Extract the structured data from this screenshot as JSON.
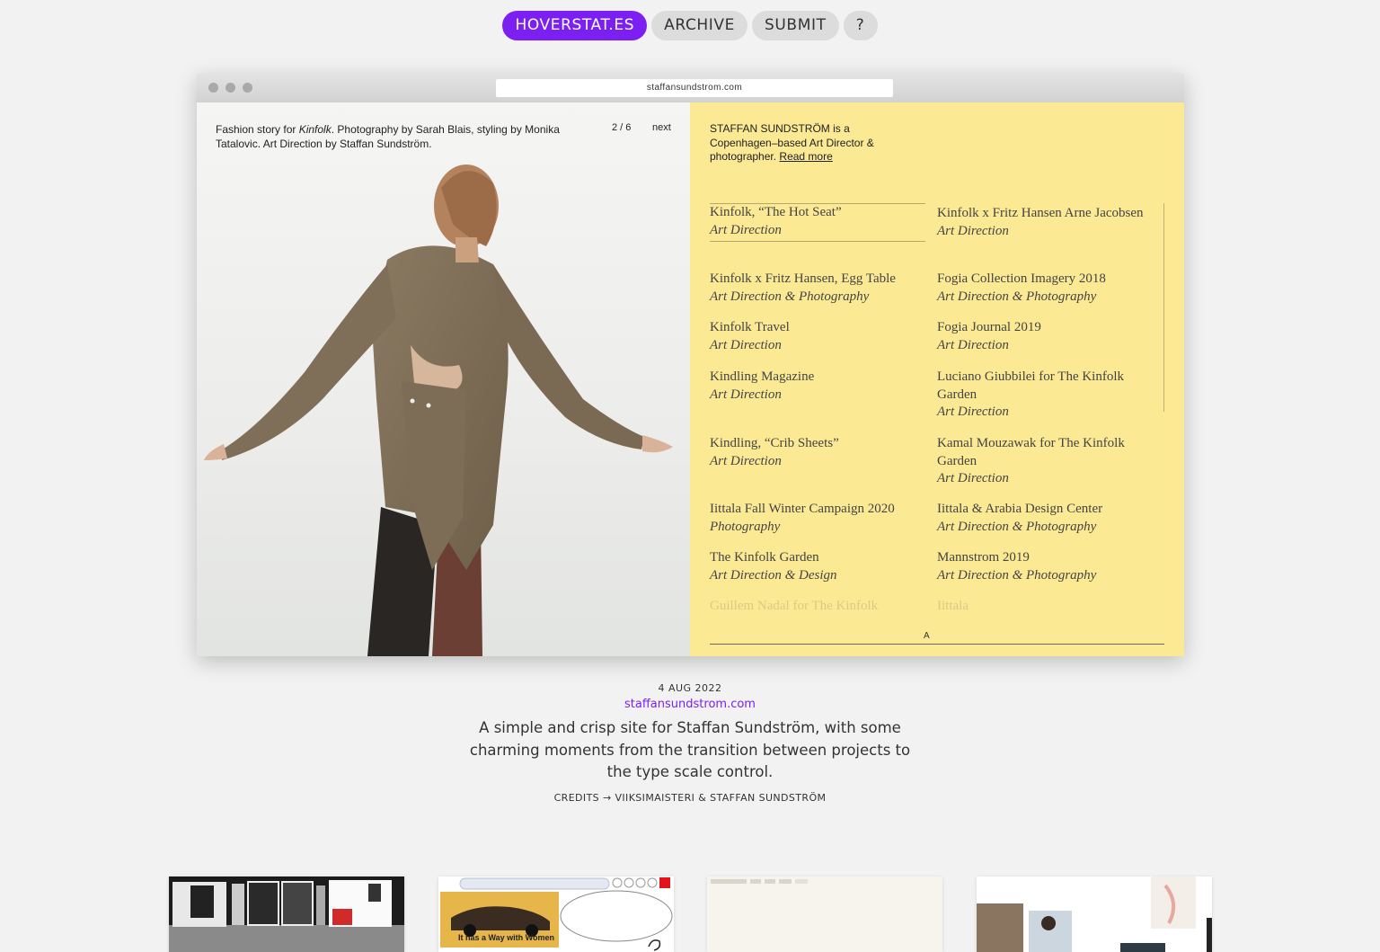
{
  "nav": {
    "items": [
      {
        "label": "HOVERSTAT.ES",
        "primary": true
      },
      {
        "label": "ARCHIVE",
        "primary": false
      },
      {
        "label": "SUBMIT",
        "primary": false
      },
      {
        "label": "?",
        "primary": false
      }
    ]
  },
  "browser": {
    "url": "staffansundstrom.com"
  },
  "site": {
    "caption_pre": "Fashion story for ",
    "caption_em": "Kinfolk",
    "caption_post": ". Photography by Sarah Blais, styling by Monika Tatalovic. Art Direction by Staffan Sundström.",
    "pager": "2 / 6",
    "next": "next",
    "intro_text": "STAFFAN SUNDSTRÖM is a Copenhagen–based Art Director & photographer. ",
    "intro_link": "Read more",
    "projects_left": [
      {
        "title": "Kinfolk, “The Hot Seat”",
        "sub": "Art Direction"
      },
      {
        "title": "Kinfolk x Fritz Hansen, Egg Table",
        "sub": "Art Direction & Photography"
      },
      {
        "title": "Kinfolk Travel",
        "sub": "Art Direction"
      },
      {
        "title": "Kindling Magazine",
        "sub": "Art Direction"
      },
      {
        "title": "Kindling, “Crib Sheets”",
        "sub": "Art Direction"
      },
      {
        "title": "Iittala Fall Winter Campaign 2020",
        "sub": "Photography"
      },
      {
        "title": "The Kinfolk Garden",
        "sub": "Art Direction & Design"
      },
      {
        "title": "Guillem Nadal for The Kinfolk",
        "sub": ""
      }
    ],
    "projects_right": [
      {
        "title": "Kinfolk x Fritz Hansen Arne Jacobsen",
        "sub": "Art Direction"
      },
      {
        "title": "Fogia Collection Imagery 2018",
        "sub": "Art Direction & Photography"
      },
      {
        "title": "Fogia Journal 2019",
        "sub": "Art Direction"
      },
      {
        "title": "Luciano Giubbilei for The Kinfolk Garden",
        "sub": "Art Direction"
      },
      {
        "title": "Kamal Mouzawak for The Kinfolk Garden",
        "sub": "Art Direction"
      },
      {
        "title": "Iittala & Arabia Design Center",
        "sub": "Art Direction & Photography"
      },
      {
        "title": "Mannstrom 2019",
        "sub": "Art Direction & Photography"
      },
      {
        "title": "Iittala",
        "sub": ""
      }
    ],
    "scale_label": "A"
  },
  "entry": {
    "date": "4 AUG 2022",
    "url": "staffansundstrom.com",
    "description": "A simple and crisp site for Staffan Sundström, with some charming moments from the transition between projects to the type scale control.",
    "credits": "CREDITS → VIIKSIMAISTERI & STAFFAN SUNDSTRÖM"
  },
  "thumbnails": {
    "t2_caption": "It has a Way with Women"
  },
  "colors": {
    "accent": "#7b1ff2",
    "panel_yellow": "#fbe994",
    "background": "#f2f2f2"
  }
}
